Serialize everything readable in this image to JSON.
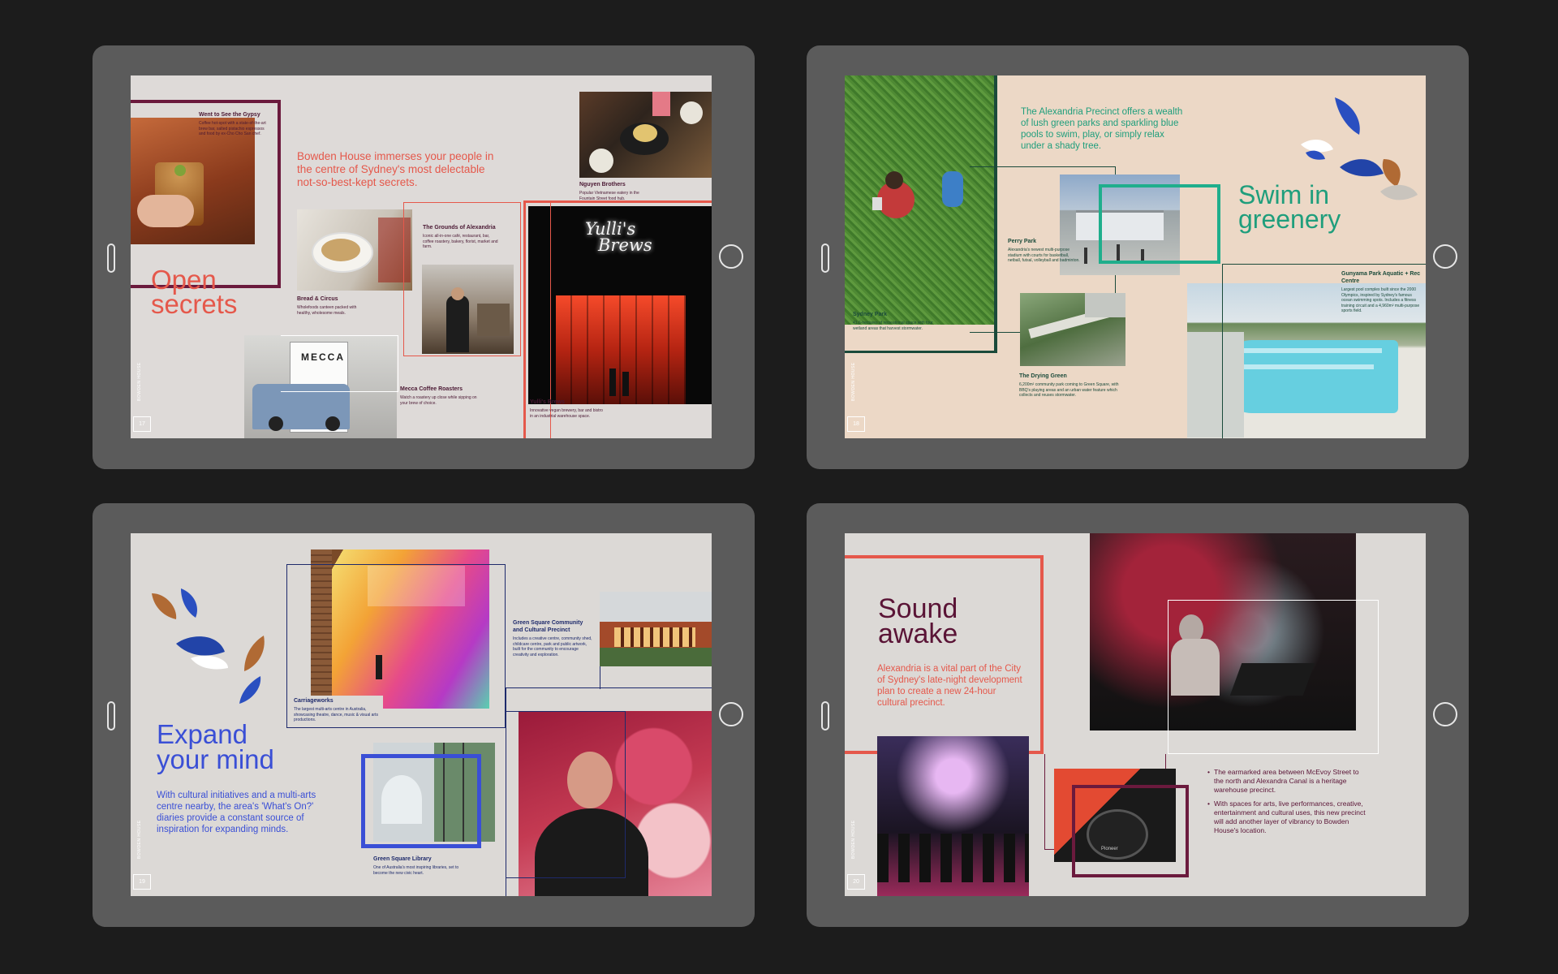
{
  "pages": [
    {
      "number": "17",
      "brand": "BOWDEN HOUSE",
      "title_line1": "Open",
      "title_line2": "secrets",
      "intro": "Bowden House immerses your people in the centre of Sydney's most delectable not-so-best-kept secrets.",
      "venues": [
        {
          "name": "Went to See the Gypsy",
          "desc": "Coffee hot-spot with a state-of-the-art brew bar, salted pistachio espressos and food by ex-Cho Cho San chef."
        },
        {
          "name": "Nguyen Brothers",
          "desc": "Popular Vietnamese eatery in the Fountain Street food hub."
        },
        {
          "name": "The Grounds of Alexandria",
          "desc": "Iconic all-in-one café, restaurant, bar, coffee roastery, bakery, florist, market and farm."
        },
        {
          "name": "Bread & Circus",
          "desc": "Wholefoods canteen packed with healthy, wholesome meals."
        },
        {
          "name": "Mecca Coffee Roasters",
          "desc": "Watch a roastery up close while sipping on your brew of choice."
        },
        {
          "name": "Yulli's Brews",
          "desc": "Innovative vegan brewery, bar and bistro in an industrial warehouse space."
        }
      ],
      "neon_line1": "Yulli's",
      "neon_line2": "Brews",
      "signage": "MECCA",
      "colors": {
        "title": "#e5584b",
        "frame": "#6b1a3d"
      }
    },
    {
      "number": "18",
      "brand": "BOWDEN HOUSE",
      "title_line1": "Swim in",
      "title_line2": "greenery",
      "intro": "The Alexandria Precinct offers a wealth of lush green parks and sparkling blue pools to swim, play, or simply relax under a shady tree.",
      "venues": [
        {
          "name": "Sydney Park",
          "desc": "41.6-hectares of recreational space with four wetland areas that harvest stormwater."
        },
        {
          "name": "Perry Park",
          "desc": "Alexandria's newest multi-purpose stadium with courts for basketball, netball, futsal, volleyball and badminton."
        },
        {
          "name": "Gunyama Park Aquatic + Rec Centre",
          "desc": "Largest pool complex built since the 2000 Olympics, inspired by Sydney's famous ocean swimming spots. Includes a fitness training circuit and a 4,960m² multi-purpose sports field."
        },
        {
          "name": "The Drying Green",
          "desc": "6,200m² community park coming to Green Square, with BBQ's playing areas and an urban water feature which collects and reuses stormwater."
        }
      ],
      "colors": {
        "title": "#1f9e7c",
        "frame": "#1a4a3a"
      }
    },
    {
      "number": "19",
      "brand": "BOWDEN HOUSE",
      "title_line1": "Expand",
      "title_line2": "your mind",
      "intro": "With cultural initiatives and a multi-arts centre nearby, the area's 'What's On?' diaries provide a constant source of inspiration for expanding minds.",
      "venues": [
        {
          "name": "Carriageworks",
          "desc": "The largest multi-arts centre in Australia, showcasing theatre, dance, music & visual arts productions."
        },
        {
          "name": "Green Square Community and Cultural Precinct",
          "desc": "Includes a creative centre, community shed, childcare centre, park and public artwork, built for the community to encourage creativity and exploration."
        },
        {
          "name": "Green Square Library",
          "desc": "One of Australia's most inspiring libraries, set to become the new civic heart."
        }
      ],
      "colors": {
        "title": "#3a4fd6",
        "frame": "#1e2a6b"
      }
    },
    {
      "number": "20",
      "brand": "BOWDEN HOUSE",
      "title_line1": "Sound",
      "title_line2": "awake",
      "intro": "Alexandria is a vital part of the City of Sydney's late-night development plan to create a new 24-hour cultural precinct.",
      "bullets": [
        "The earmarked area between McEvoy Street to the north and Alexandra Canal is a heritage warehouse precinct.",
        "With spaces for arts, live performances, creative, entertainment and cultural uses, this new precinct will add another layer of vibrancy to Bowden House's location."
      ],
      "turntable_brand": "Pioneer",
      "colors": {
        "title": "#5a1436",
        "accent": "#e5584b"
      }
    }
  ]
}
